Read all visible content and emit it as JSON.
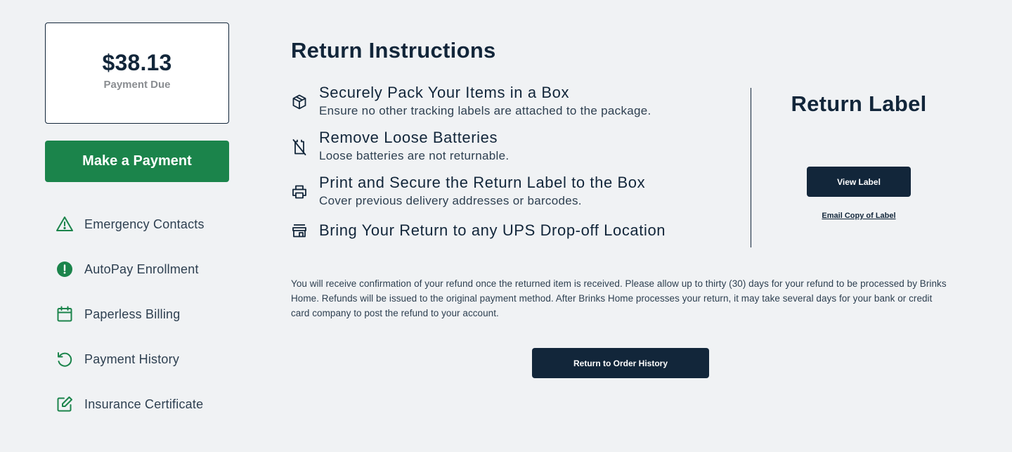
{
  "sidebar": {
    "payment": {
      "amount": "$38.13",
      "label": "Payment Due"
    },
    "make_payment_label": "Make a Payment",
    "nav_items": [
      {
        "label": "Emergency Contacts",
        "icon": "warning-triangle-icon"
      },
      {
        "label": "AutoPay Enrollment",
        "icon": "alert-circle-icon"
      },
      {
        "label": "Paperless Billing",
        "icon": "calendar-icon"
      },
      {
        "label": "Payment History",
        "icon": "history-icon"
      },
      {
        "label": "Insurance Certificate",
        "icon": "edit-icon"
      }
    ]
  },
  "main": {
    "title": "Return Instructions",
    "steps": [
      {
        "heading": "Securely Pack Your Items in a Box",
        "detail": "Ensure no other tracking labels are attached to the package.",
        "icon": "package-icon"
      },
      {
        "heading": "Remove Loose Batteries",
        "detail": "Loose batteries are not returnable.",
        "icon": "no-battery-icon"
      },
      {
        "heading": "Print and Secure the Return Label to the Box",
        "detail": "Cover previous delivery addresses or barcodes.",
        "icon": "printer-icon"
      },
      {
        "heading": "Bring Your Return to any UPS Drop-off Location",
        "detail": "",
        "icon": "store-icon"
      }
    ],
    "refund_note": "You will receive confirmation of your refund once the returned item is received. Please allow up to thirty (30) days for your refund to be processed by Brinks Home. Refunds will be issued to the original payment method. After Brinks Home processes your return, it may take several days for your bank or credit card company to post the refund to your account.",
    "return_button_label": "Return to Order History"
  },
  "label_panel": {
    "title": "Return Label",
    "view_button_label": "View Label",
    "email_link_label": "Email Copy of Label"
  },
  "colors": {
    "background": "#f0f2f4",
    "primary_dark": "#12263a",
    "brand_green": "#1b844b",
    "muted_gray": "#8a8d91"
  }
}
